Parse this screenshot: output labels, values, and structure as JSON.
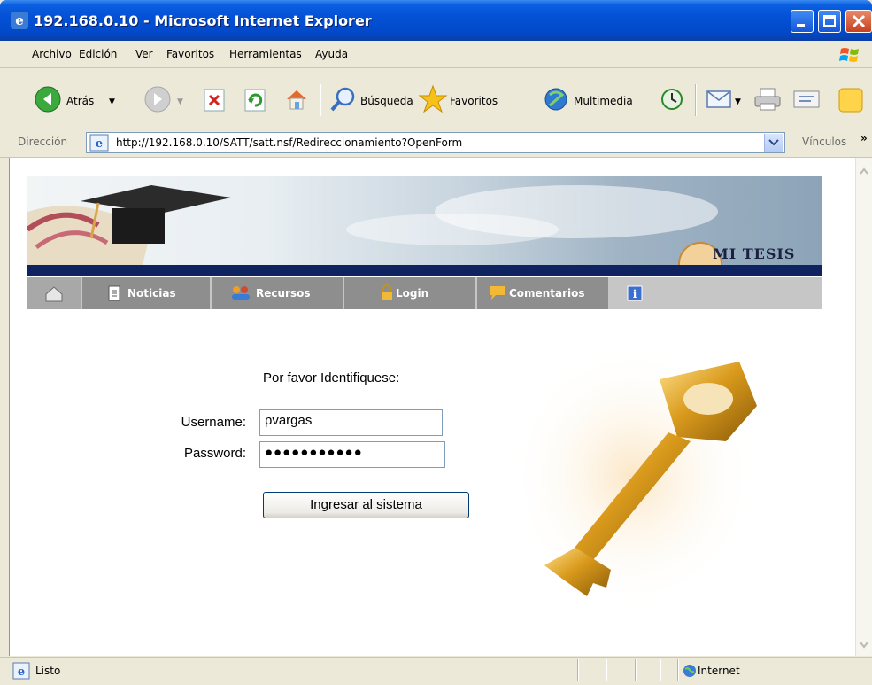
{
  "window": {
    "title": "192.168.0.10 - Microsoft Internet Explorer"
  },
  "menu": [
    "Archivo",
    "Edición",
    "Ver",
    "Favoritos",
    "Herramientas",
    "Ayuda"
  ],
  "toolbar": {
    "back": "Atrás",
    "search": "Búsqueda",
    "favorites": "Favoritos",
    "media": "Multimedia"
  },
  "address": {
    "label": "Dirección",
    "url": "http://192.168.0.10/SATT/satt.nsf/Redireccionamiento?OpenForm",
    "links": "Vínculos"
  },
  "banner": {
    "brand": "Mi Tesis"
  },
  "nav": [
    "Noticias",
    "Recursos",
    "Login",
    "Comentarios"
  ],
  "login": {
    "prompt": "Por favor Identifiquese:",
    "username_label": "Username:",
    "username_value": "pvargas",
    "password_label": "Password:",
    "password_value": "●●●●●●●●●●●",
    "submit": "Ingresar al sistema"
  },
  "status": {
    "text": "Listo",
    "zone": "Internet"
  },
  "colors": {
    "titlebar": "#0551d6",
    "nav_active": "#8e8e8e",
    "banner_line": "#0f2360",
    "key_gold": "#d99a1c"
  }
}
